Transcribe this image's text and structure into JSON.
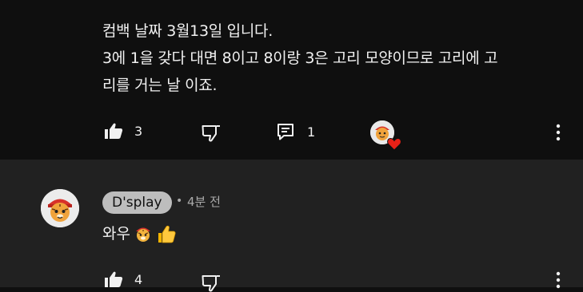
{
  "top_comment": {
    "lines": [
      "컴백 날짜 3월13일 입니다.",
      "3에 1을 갖다 대면 8이고 8이랑 3은 고리 모양이므로 고리에 고",
      "리를 거는 날 이죠."
    ],
    "like_count": "3",
    "reply_count": "1"
  },
  "reply": {
    "author": "D'splay",
    "separator": "•",
    "time_ago": "4분 전",
    "text": "와우",
    "like_count": "4"
  },
  "colors": {
    "background": "#0f0f0f",
    "reply_background": "#212121",
    "heart": "#e62117",
    "chip": "#bdbdbd"
  },
  "icons": [
    "thumbs-up-icon",
    "thumbs-down-icon",
    "reply-icon",
    "more-vert-icon",
    "heart-icon",
    "tiger-emoji",
    "thumbs-up-emoji"
  ]
}
